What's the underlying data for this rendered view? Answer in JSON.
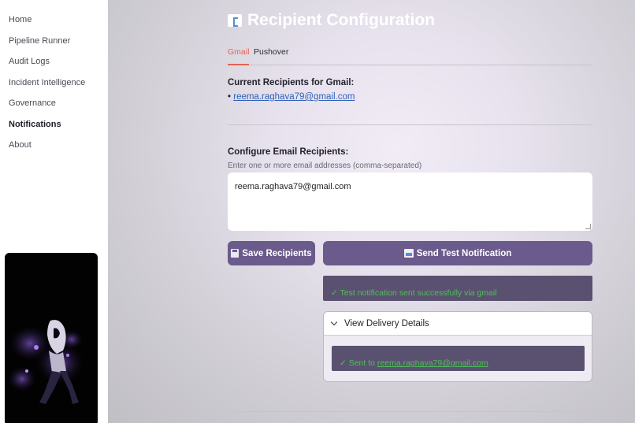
{
  "sidebar": {
    "items": [
      {
        "label": "Home"
      },
      {
        "label": "Pipeline Runner"
      },
      {
        "label": "Audit Logs"
      },
      {
        "label": "Incident Intelligence"
      },
      {
        "label": "Governance"
      },
      {
        "label": "Notifications",
        "active": true
      },
      {
        "label": "About"
      }
    ]
  },
  "page": {
    "title": "Recipient Configuration",
    "title_icon": "email-icon"
  },
  "tabs": [
    {
      "label": "Gmail",
      "active": true
    },
    {
      "label": "Pushover"
    }
  ],
  "current": {
    "heading": "Current Recipients for Gmail:",
    "bullet": "•",
    "recipients": [
      "reema.raghava79@gmail.com"
    ]
  },
  "configure": {
    "heading": "Configure Email Recipients:",
    "help": "Enter one or more email addresses (comma-separated)",
    "value": "reema.raghava79@gmail.com"
  },
  "buttons": {
    "save_label": "Save Recipients",
    "save_icon": "floppy-disk-icon",
    "send_label": "Send Test Notification",
    "send_icon": "outbox-tray-icon"
  },
  "result": {
    "success_message": "✓ Test notification sent successfully via gmail",
    "details_label": "View Delivery Details",
    "sent_prefix": "✓ Sent to ",
    "sent_to": "reema.raghava79@gmail.com"
  },
  "colors": {
    "accent": "#e36452",
    "button": "#6b5a8c",
    "success_text": "#4fbf59",
    "alert_bg": "#5a5170"
  }
}
